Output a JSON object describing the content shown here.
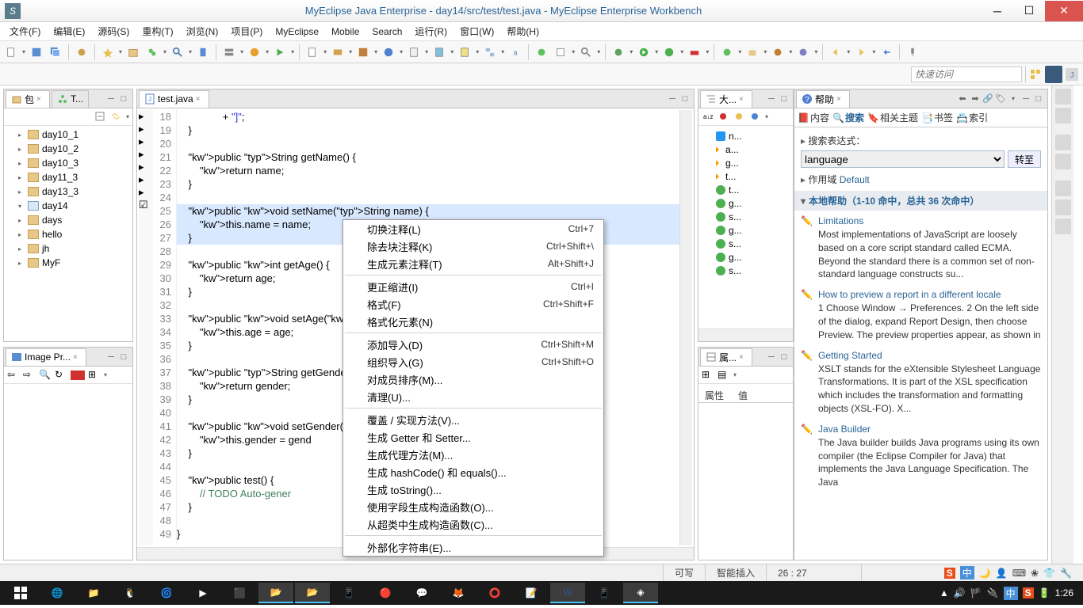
{
  "titlebar": {
    "title": "MyEclipse Java Enterprise - day14/src/test/test.java - MyEclipse Enterprise Workbench"
  },
  "menu": [
    "文件(F)",
    "编辑(E)",
    "源码(S)",
    "重构(T)",
    "浏览(N)",
    "项目(P)",
    "MyEclipse",
    "Mobile",
    "Search",
    "运行(R)",
    "窗口(W)",
    "帮助(H)"
  ],
  "quick_access_placeholder": "快速访问",
  "explorer": {
    "tab1": "包",
    "tab2": "T...",
    "items": [
      {
        "label": "day10_1",
        "type": "folder"
      },
      {
        "label": "day10_2",
        "type": "folder"
      },
      {
        "label": "day10_3",
        "type": "folder"
      },
      {
        "label": "day11_3",
        "type": "folder"
      },
      {
        "label": "day13_3",
        "type": "folder"
      },
      {
        "label": "day14",
        "type": "project",
        "expanded": true
      },
      {
        "label": "days",
        "type": "folder"
      },
      {
        "label": "hello",
        "type": "folder"
      },
      {
        "label": "jh",
        "type": "folder"
      },
      {
        "label": "MyF",
        "type": "folder"
      }
    ]
  },
  "image_preview_tab": "Image Pr...",
  "editor": {
    "tab": "test.java",
    "lines": [
      {
        "n": 18,
        "t": "                + \"]\";",
        "type": "str"
      },
      {
        "n": 19,
        "t": "    }"
      },
      {
        "n": 20,
        "t": ""
      },
      {
        "n": 21,
        "t": "    public String getName() {",
        "m": "▸"
      },
      {
        "n": 22,
        "t": "        return name;"
      },
      {
        "n": 23,
        "t": "    }"
      },
      {
        "n": 24,
        "t": ""
      },
      {
        "n": 25,
        "t": "    public void setName(String name) {",
        "m": "▸",
        "hl": true
      },
      {
        "n": 26,
        "t": "        this.name = name;",
        "hl": true
      },
      {
        "n": 27,
        "t": "    }",
        "hl": true
      },
      {
        "n": 28,
        "t": ""
      },
      {
        "n": 29,
        "t": "    public int getAge() {",
        "m": "▸"
      },
      {
        "n": 30,
        "t": "        return age;"
      },
      {
        "n": 31,
        "t": "    }"
      },
      {
        "n": 32,
        "t": ""
      },
      {
        "n": 33,
        "t": "    public void setAge(int",
        "m": "▸"
      },
      {
        "n": 34,
        "t": "        this.age = age;"
      },
      {
        "n": 35,
        "t": "    }"
      },
      {
        "n": 36,
        "t": ""
      },
      {
        "n": 37,
        "t": "    public String getGende",
        "m": "▸"
      },
      {
        "n": 38,
        "t": "        return gender;"
      },
      {
        "n": 39,
        "t": "    }"
      },
      {
        "n": 40,
        "t": ""
      },
      {
        "n": 41,
        "t": "    public void setGender(",
        "m": "▸"
      },
      {
        "n": 42,
        "t": "        this.gender = gend"
      },
      {
        "n": 43,
        "t": "    }"
      },
      {
        "n": 44,
        "t": ""
      },
      {
        "n": 45,
        "t": "    public test() {",
        "m": "▸"
      },
      {
        "n": 46,
        "t": "        // TODO Auto-gener",
        "m": "☑",
        "cmt": true
      },
      {
        "n": 47,
        "t": "    }"
      },
      {
        "n": 48,
        "t": ""
      },
      {
        "n": 49,
        "t": "}"
      }
    ]
  },
  "ctxmenu": [
    {
      "label": "切换注释(L)",
      "sc": "Ctrl+7"
    },
    {
      "label": "除去块注释(K)",
      "sc": "Ctrl+Shift+\\"
    },
    {
      "label": "生成元素注释(T)",
      "sc": "Alt+Shift+J"
    },
    {
      "sep": true
    },
    {
      "label": "更正缩进(I)",
      "sc": "Ctrl+I"
    },
    {
      "label": "格式(F)",
      "sc": "Ctrl+Shift+F"
    },
    {
      "label": "格式化元素(N)"
    },
    {
      "sep": true
    },
    {
      "label": "添加导入(D)",
      "sc": "Ctrl+Shift+M"
    },
    {
      "label": "组织导入(G)",
      "sc": "Ctrl+Shift+O"
    },
    {
      "label": "对成员排序(M)..."
    },
    {
      "label": "清理(U)..."
    },
    {
      "sep": true
    },
    {
      "label": "覆盖 / 实现方法(V)..."
    },
    {
      "label": "生成 Getter 和 Setter..."
    },
    {
      "label": "生成代理方法(M)..."
    },
    {
      "label": "生成 hashCode() 和 equals()..."
    },
    {
      "label": "生成 toString()..."
    },
    {
      "label": "使用字段生成构造函数(O)..."
    },
    {
      "label": "从超类中生成构造函数(C)..."
    },
    {
      "sep": true
    },
    {
      "label": "外部化字符串(E)..."
    }
  ],
  "outline": {
    "tab": "大...",
    "items": [
      "n...",
      "a...",
      "g...",
      "t...",
      "t...",
      "g...",
      "s...",
      "g...",
      "s...",
      "g...",
      "s..."
    ]
  },
  "properties": {
    "tab": "属...",
    "col1": "属性",
    "col2": "值"
  },
  "help": {
    "tab": "帮助",
    "navtabs": {
      "content": "内容",
      "search": "搜索",
      "related": "相关主题",
      "bookmarks": "书签",
      "index": "索引"
    },
    "search_label": "搜索表达式：",
    "search_value": "language",
    "go_btn": "转至",
    "scope_label": "作用域",
    "scope_value": "Default",
    "section": "本地帮助（1-10 命中，总共 36 次命中）",
    "results": [
      {
        "title": "Limitations",
        "text": "Most implementations of JavaScript are loosely based on a core script standard called ECMA. Beyond the standard there is a common set of non-standard language constructs su..."
      },
      {
        "title": "How to preview a report in a different locale",
        "text": "1 Choose Window → Preferences. 2 On the left side of the dialog, expand Report Design, then choose Preview. The preview properties appear, as shown in"
      },
      {
        "title": "Getting Started",
        "text": "XSLT stands for the eXtensible Stylesheet Language Transformations. It is part of the XSL specification which includes the transformation and formatting objects (XSL-FO). X..."
      },
      {
        "title": "Java Builder",
        "text": "The Java builder builds Java programs using its own compiler (the Eclipse Compiler for Java) that implements the Java Language Specification. The Java"
      }
    ]
  },
  "status": {
    "writable": "可写",
    "insert": "智能插入",
    "cursor": "26 : 27"
  },
  "tray": {
    "ime": "中",
    "clock": "1:26"
  }
}
